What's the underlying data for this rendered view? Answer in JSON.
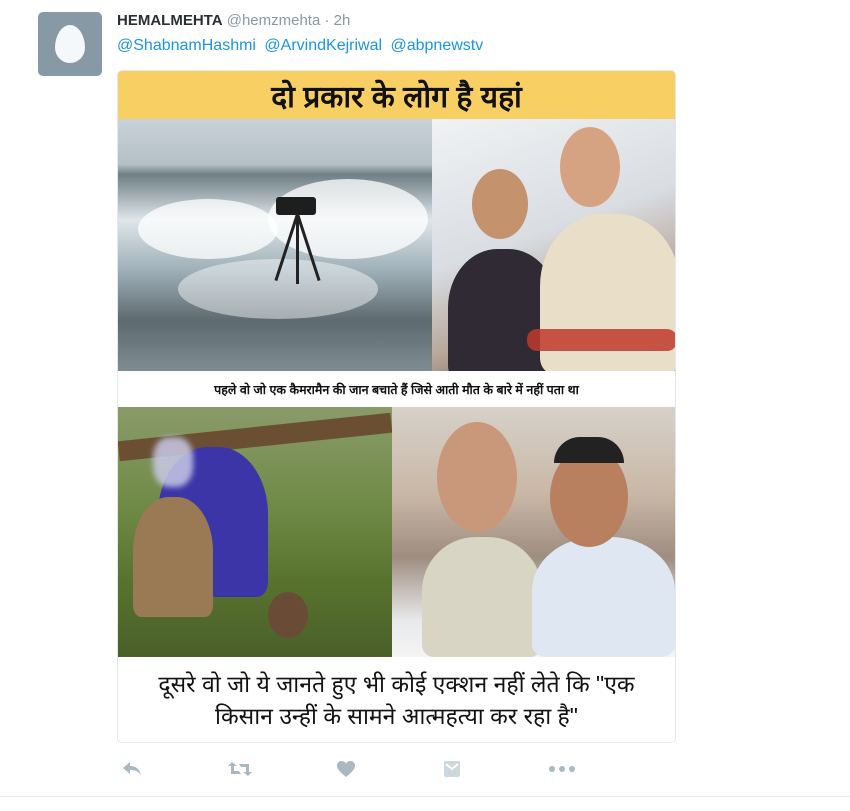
{
  "tweet": {
    "author_name": "HEMALMEHTA",
    "author_handle": "@hemzmehta",
    "separator": "·",
    "time": "2h",
    "mentions": [
      "@ShabnamHashmi",
      "@ArvindKejriwal",
      "@abpnewstv"
    ]
  },
  "media": {
    "title": "दो प्रकार के लोग है यहां",
    "caption_top": "पहले वो जो एक कैमरामैन की जान बचाते हैं जिसे आती मौत के बारे में नहीं पता था",
    "caption_bottom_line1": "दूसरे वो जो ये जानते हुए भी कोई एक्शन नहीं लेते कि \"एक",
    "caption_bottom_line2": "किसान उन्हीं के सामने आत्महत्या कर रहा है\""
  },
  "actions": {
    "reply_icon": "reply-icon",
    "retweet_icon": "retweet-icon",
    "like_icon": "heart-icon",
    "dm_icon": "direct-message-icon",
    "more_icon": "more-icon"
  },
  "colors": {
    "link": "#1b95e0",
    "muted": "#8899a6",
    "title_bg": "#f8cf63",
    "action_icon": "#aab8c2"
  }
}
